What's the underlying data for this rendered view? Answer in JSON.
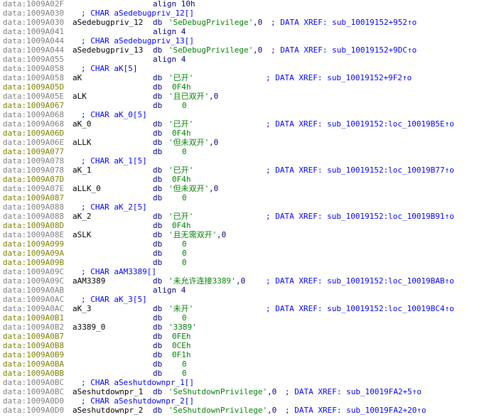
{
  "colors": {
    "background": "#ffffff",
    "address_defined": "#808080",
    "address_undefined": "#808000",
    "label": "#000000",
    "mnemonic": "#000080",
    "string_literal": "#008000",
    "comment": "#0000ff"
  },
  "lines": [
    {
      "addr": "data:1009A02F",
      "undef": false,
      "mnem": "align 10h"
    },
    {
      "addr": "data:1009A030",
      "undef": false,
      "decl": "; CHAR aSedebugpriv_12[]"
    },
    {
      "addr": "data:1009A030",
      "undef": false,
      "label": "aSedebugpriv_12",
      "mnem": "db",
      "str": "'SeDebugPrivilege'",
      "rest": ",0",
      "cmt": "; DATA XREF: sub_10019152+952↑o"
    },
    {
      "addr": "data:1009A041",
      "undef": false,
      "mnem": "align 4"
    },
    {
      "addr": "data:1009A044",
      "undef": false,
      "decl": "; CHAR aSedebugpriv_13[]"
    },
    {
      "addr": "data:1009A044",
      "undef": false,
      "label": "aSedebugpriv_13",
      "mnem": "db",
      "str": "'SeDebugPrivilege'",
      "rest": ",0",
      "cmt": "; DATA XREF: sub_10019152+9DC↑o"
    },
    {
      "addr": "data:1009A055",
      "undef": false,
      "mnem": "align 4"
    },
    {
      "addr": "data:1009A058",
      "undef": false,
      "decl": "; CHAR aK[5]"
    },
    {
      "addr": "data:1009A058",
      "undef": false,
      "label": "aK",
      "mnem": "db",
      "str": "'已开'",
      "rest": "",
      "cmt": "; DATA XREF: sub_10019152+9F2↑o"
    },
    {
      "addr": "data:1009A05D",
      "undef": true,
      "mnem": "db",
      "rest": "0F4h"
    },
    {
      "addr": "data:1009A05E",
      "undef": false,
      "label": "aLK",
      "mnem": "db",
      "str": "'且已双开'",
      "rest": ",0"
    },
    {
      "addr": "data:1009A067",
      "undef": true,
      "mnem": "db",
      "rest": "0"
    },
    {
      "addr": "data:1009A068",
      "undef": false,
      "decl": "; CHAR aK_0[5]"
    },
    {
      "addr": "data:1009A068",
      "undef": false,
      "label": "aK_0",
      "mnem": "db",
      "str": "'已开'",
      "rest": "",
      "cmt": "; DATA XREF: sub_10019152:loc_10019B5E↑o"
    },
    {
      "addr": "data:1009A06D",
      "undef": true,
      "mnem": "db",
      "rest": "0F4h"
    },
    {
      "addr": "data:1009A06E",
      "undef": false,
      "label": "aLLK",
      "mnem": "db",
      "str": "'但未双开'",
      "rest": ",0"
    },
    {
      "addr": "data:1009A077",
      "undef": true,
      "mnem": "db",
      "rest": "0"
    },
    {
      "addr": "data:1009A078",
      "undef": false,
      "decl": "; CHAR aK_1[5]"
    },
    {
      "addr": "data:1009A078",
      "undef": false,
      "label": "aK_1",
      "mnem": "db",
      "str": "'已开'",
      "rest": "",
      "cmt": "; DATA XREF: sub_10019152:loc_10019B77↑o"
    },
    {
      "addr": "data:1009A07D",
      "undef": true,
      "mnem": "db",
      "rest": "0F4h"
    },
    {
      "addr": "data:1009A07E",
      "undef": false,
      "label": "aLLK_0",
      "mnem": "db",
      "str": "'但未双开'",
      "rest": ",0"
    },
    {
      "addr": "data:1009A087",
      "undef": true,
      "mnem": "db",
      "rest": "0"
    },
    {
      "addr": "data:1009A088",
      "undef": false,
      "decl": "; CHAR aK_2[5]"
    },
    {
      "addr": "data:1009A088",
      "undef": false,
      "label": "aK_2",
      "mnem": "db",
      "str": "'已开'",
      "rest": "",
      "cmt": "; DATA XREF: sub_10019152:loc_10019B91↑o"
    },
    {
      "addr": "data:1009A08D",
      "undef": true,
      "mnem": "db",
      "rest": "0F4h"
    },
    {
      "addr": "data:1009A08E",
      "undef": false,
      "label": "aSLK",
      "mnem": "db",
      "str": "'且无需双开'",
      "rest": ",0"
    },
    {
      "addr": "data:1009A099",
      "undef": true,
      "mnem": "db",
      "rest": "0"
    },
    {
      "addr": "data:1009A09A",
      "undef": true,
      "mnem": "db",
      "rest": "0"
    },
    {
      "addr": "data:1009A09B",
      "undef": true,
      "mnem": "db",
      "rest": "0"
    },
    {
      "addr": "data:1009A09C",
      "undef": false,
      "decl": "; CHAR aAM3389[]"
    },
    {
      "addr": "data:1009A09C",
      "undef": false,
      "label": "aAM3389",
      "mnem": "db",
      "str": "'未允许连接3389'",
      "rest": ",0",
      "cmt": "; DATA XREF: sub_10019152:loc_10019BAB↑o"
    },
    {
      "addr": "data:1009A0AB",
      "undef": false,
      "mnem": "align 4"
    },
    {
      "addr": "data:1009A0AC",
      "undef": false,
      "decl": "; CHAR aK_3[5]"
    },
    {
      "addr": "data:1009A0AC",
      "undef": false,
      "label": "aK_3",
      "mnem": "db",
      "str": "'未开'",
      "rest": "",
      "cmt": "; DATA XREF: sub_10019152:loc_10019BC4↑o"
    },
    {
      "addr": "data:1009A0B1",
      "undef": true,
      "mnem": "db",
      "rest": "0"
    },
    {
      "addr": "data:1009A0B2",
      "undef": false,
      "label": "a3389_0",
      "mnem": "db",
      "str": "'3389'",
      "rest": ""
    },
    {
      "addr": "data:1009A0B7",
      "undef": true,
      "mnem": "db",
      "rest": "0FEh"
    },
    {
      "addr": "data:1009A0B8",
      "undef": true,
      "mnem": "db",
      "rest": "0CEh"
    },
    {
      "addr": "data:1009A0B9",
      "undef": true,
      "mnem": "db",
      "rest": "0F1h"
    },
    {
      "addr": "data:1009A0BA",
      "undef": true,
      "mnem": "db",
      "rest": "0"
    },
    {
      "addr": "data:1009A0BB",
      "undef": true,
      "mnem": "db",
      "rest": "0"
    },
    {
      "addr": "data:1009A0BC",
      "undef": false,
      "decl": "; CHAR aSeshutdownpr_1[]"
    },
    {
      "addr": "data:1009A0BC",
      "undef": false,
      "label": "aSeshutdownpr_1",
      "mnem": "db",
      "str": "'SeShutdownPrivilege'",
      "rest": ",0",
      "cmt": "; DATA XREF: sub_10019FA2+5↑o"
    },
    {
      "addr": "data:1009A0D0",
      "undef": false,
      "decl": "; CHAR aSeshutdownpr_2[]"
    },
    {
      "addr": "data:1009A0D0",
      "undef": false,
      "label": "aSeshutdownpr_2",
      "mnem": "db",
      "str": "'SeShutdownPrivilege'",
      "rest": ",0",
      "cmt": "; DATA XREF: sub_10019FA2+20↑o"
    }
  ]
}
